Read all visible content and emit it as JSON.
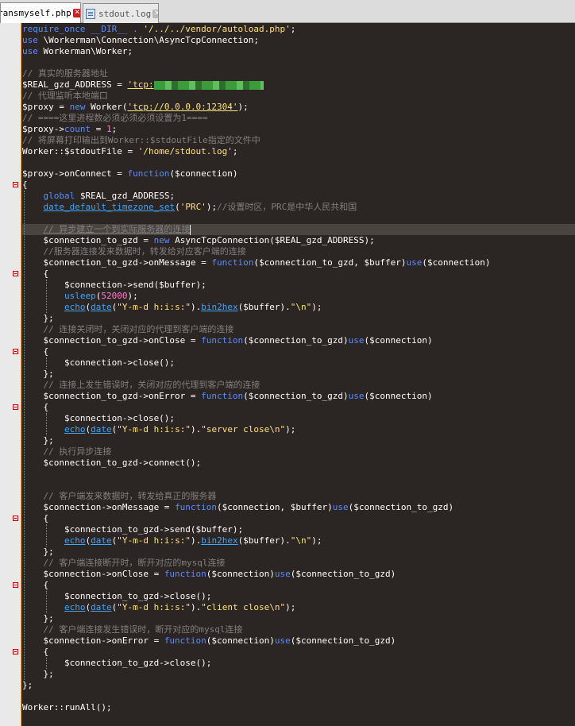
{
  "tabs": [
    {
      "label": "ransmyself.php",
      "active": true
    },
    {
      "label": "stdout.log",
      "active": false
    }
  ],
  "code_lines": [
    [
      [
        "kw",
        "require_once __DIR__ . "
      ],
      [
        "str",
        "'/../../vendor/autoload.php'"
      ],
      [
        "var",
        ";"
      ]
    ],
    [
      [
        "kw",
        "use "
      ],
      [
        "var",
        "\\Workerman\\Connection\\AsyncTcpConnection;"
      ]
    ],
    [
      [
        "kw",
        "use "
      ],
      [
        "var",
        "Workerman\\Worker;"
      ]
    ],
    [],
    [
      [
        "cm",
        "// 真实的服务器地址"
      ]
    ],
    [
      [
        "var",
        "$REAL_gzd_ADDRESS = "
      ],
      [
        "str",
        "'tcp:"
      ]
    ],
    [
      [
        "cm",
        "// 代理监听本地端口"
      ]
    ],
    [
      [
        "var",
        "$proxy = "
      ],
      [
        "kw",
        "new "
      ],
      [
        "var",
        "Worker("
      ],
      [
        "str",
        "'tcp://0.0.0.0:12304'"
      ],
      [
        "var",
        ");"
      ]
    ],
    [
      [
        "cm",
        "// ====这里进程数必须必须必须设置为1===="
      ]
    ],
    [
      [
        "var",
        "$proxy->"
      ],
      [
        "kw",
        "count"
      ],
      [
        "var",
        " = "
      ],
      [
        "num",
        "1"
      ],
      [
        "var",
        ";"
      ]
    ],
    [
      [
        "cm",
        "// 将屏幕打印输出到Worker::$stdoutFile指定的文件中"
      ]
    ],
    [
      [
        "var",
        "Worker::$stdoutFile = "
      ],
      [
        "str",
        "'/home/stdout.log'"
      ],
      [
        "var",
        ";"
      ]
    ],
    [],
    [
      [
        "var",
        "$proxy->onConnect = "
      ],
      [
        "kw",
        "function"
      ],
      [
        "var",
        "($connection)"
      ]
    ],
    [
      [
        "var",
        "{"
      ]
    ],
    [
      [
        "var",
        "    "
      ],
      [
        "kw",
        "global "
      ],
      [
        "var",
        "$REAL_gzd_ADDRESS;"
      ]
    ],
    [
      [
        "var",
        "    "
      ],
      [
        "fn2",
        "date_default_timezone_set"
      ],
      [
        "var",
        "("
      ],
      [
        "str",
        "'PRC'"
      ],
      [
        "var",
        ");"
      ],
      [
        "cm",
        "//设置时区，PRC是中华人民共和国"
      ]
    ],
    [],
    [
      [
        "var",
        "    "
      ],
      [
        "cm",
        "// 异步建立一个到实际服务器的连接"
      ]
    ],
    [
      [
        "var",
        "    $connection_to_gzd = "
      ],
      [
        "kw",
        "new "
      ],
      [
        "var",
        "AsyncTcpConnection($REAL_gzd_ADDRESS);"
      ]
    ],
    [
      [
        "var",
        "    "
      ],
      [
        "cm",
        "//服务器连接发来数据时，转发给对应客户端的连接"
      ]
    ],
    [
      [
        "var",
        "    $connection_to_gzd->onMessage = "
      ],
      [
        "kw",
        "function"
      ],
      [
        "var",
        "($connection_to_gzd, $buffer)"
      ],
      [
        "kw",
        "use"
      ],
      [
        "var",
        "($connection)"
      ]
    ],
    [
      [
        "var",
        "    {"
      ]
    ],
    [
      [
        "var",
        "        $connection->send($buffer);"
      ]
    ],
    [
      [
        "var",
        "        "
      ],
      [
        "fn2",
        "usleep"
      ],
      [
        "var",
        "("
      ],
      [
        "num",
        "52000"
      ],
      [
        "var",
        ");"
      ]
    ],
    [
      [
        "var",
        "        "
      ],
      [
        "fn2",
        "echo"
      ],
      [
        "var",
        "("
      ],
      [
        "fn2",
        "date"
      ],
      [
        "var",
        "("
      ],
      [
        "str",
        "\"Y-m-d h:i:s:\""
      ],
      [
        "var",
        ")."
      ],
      [
        "fn2",
        "bin2hex"
      ],
      [
        "var",
        "($buffer)."
      ],
      [
        "str",
        "\"\\n\""
      ],
      [
        "var",
        ");"
      ]
    ],
    [
      [
        "var",
        "    };"
      ]
    ],
    [
      [
        "var",
        "    "
      ],
      [
        "cm",
        "// 连接关闭时，关闭对应的代理到客户端的连接"
      ]
    ],
    [
      [
        "var",
        "    $connection_to_gzd->onClose = "
      ],
      [
        "kw",
        "function"
      ],
      [
        "var",
        "($connection_to_gzd)"
      ],
      [
        "kw",
        "use"
      ],
      [
        "var",
        "($connection)"
      ]
    ],
    [
      [
        "var",
        "    {"
      ]
    ],
    [
      [
        "var",
        "        $connection->close();"
      ]
    ],
    [
      [
        "var",
        "    };"
      ]
    ],
    [
      [
        "var",
        "    "
      ],
      [
        "cm",
        "// 连接上发生错误时，关闭对应的代理到客户端的连接"
      ]
    ],
    [
      [
        "var",
        "    $connection_to_gzd->onError = "
      ],
      [
        "kw",
        "function"
      ],
      [
        "var",
        "($connection_to_gzd)"
      ],
      [
        "kw",
        "use"
      ],
      [
        "var",
        "($connection)"
      ]
    ],
    [
      [
        "var",
        "    {"
      ]
    ],
    [
      [
        "var",
        "        $connection->close();"
      ]
    ],
    [
      [
        "var",
        "        "
      ],
      [
        "fn2",
        "echo"
      ],
      [
        "var",
        "("
      ],
      [
        "fn2",
        "date"
      ],
      [
        "var",
        "("
      ],
      [
        "str",
        "\"Y-m-d h:i:s:\""
      ],
      [
        "var",
        ")."
      ],
      [
        "str",
        "\"server close\\n\""
      ],
      [
        "var",
        ");"
      ]
    ],
    [
      [
        "var",
        "    };"
      ]
    ],
    [
      [
        "var",
        "    "
      ],
      [
        "cm",
        "// 执行异步连接"
      ]
    ],
    [
      [
        "var",
        "    $connection_to_gzd->connect();"
      ]
    ],
    [],
    [],
    [
      [
        "var",
        "    "
      ],
      [
        "cm",
        "// 客户端发来数据时，转发给真正的服务器"
      ]
    ],
    [
      [
        "var",
        "    $connection->onMessage = "
      ],
      [
        "kw",
        "function"
      ],
      [
        "var",
        "($connection, $buffer)"
      ],
      [
        "kw",
        "use"
      ],
      [
        "var",
        "($connection_to_gzd)"
      ]
    ],
    [
      [
        "var",
        "    {"
      ]
    ],
    [
      [
        "var",
        "        $connection_to_gzd->send($buffer);"
      ]
    ],
    [
      [
        "var",
        "        "
      ],
      [
        "fn2",
        "echo"
      ],
      [
        "var",
        "("
      ],
      [
        "fn2",
        "date"
      ],
      [
        "var",
        "("
      ],
      [
        "str",
        "\"Y-m-d h:i:s:\""
      ],
      [
        "var",
        ")."
      ],
      [
        "fn2",
        "bin2hex"
      ],
      [
        "var",
        "($buffer)."
      ],
      [
        "str",
        "\"\\n\""
      ],
      [
        "var",
        ");"
      ]
    ],
    [
      [
        "var",
        "    };"
      ]
    ],
    [
      [
        "var",
        "    "
      ],
      [
        "cm",
        "// 客户端连接断开时，断开对应的mysql连接"
      ]
    ],
    [
      [
        "var",
        "    $connection->onClose = "
      ],
      [
        "kw",
        "function"
      ],
      [
        "var",
        "($connection)"
      ],
      [
        "kw",
        "use"
      ],
      [
        "var",
        "($connection_to_gzd)"
      ]
    ],
    [
      [
        "var",
        "    {"
      ]
    ],
    [
      [
        "var",
        "        $connection_to_gzd->close();"
      ]
    ],
    [
      [
        "var",
        "        "
      ],
      [
        "fn2",
        "echo"
      ],
      [
        "var",
        "("
      ],
      [
        "fn2",
        "date"
      ],
      [
        "var",
        "("
      ],
      [
        "str",
        "\"Y-m-d h:i:s:\""
      ],
      [
        "var",
        ")."
      ],
      [
        "str",
        "\"client close\\n\""
      ],
      [
        "var",
        ");"
      ]
    ],
    [
      [
        "var",
        "    };"
      ]
    ],
    [
      [
        "var",
        "    "
      ],
      [
        "cm",
        "// 客户端连接发生错误时，断开对应的mysql连接"
      ]
    ],
    [
      [
        "var",
        "    $connection->onError = "
      ],
      [
        "kw",
        "function"
      ],
      [
        "var",
        "($connection)"
      ],
      [
        "kw",
        "use"
      ],
      [
        "var",
        "($connection_to_gzd)"
      ]
    ],
    [
      [
        "var",
        "    {"
      ]
    ],
    [
      [
        "var",
        "        $connection_to_gzd->close();"
      ]
    ],
    [
      [
        "var",
        "    };"
      ]
    ],
    [
      [
        "var",
        "};"
      ]
    ],
    [],
    [
      [
        "var",
        "Worker::runAll();"
      ]
    ]
  ],
  "colors": {
    "editor_background": "#2b2523",
    "gutter": "#e9e9e9",
    "comment": "#808080",
    "keyword": "#5b8cff",
    "string": "#ffe27a",
    "number": "#ff7ad0",
    "builtin": "#3da5ff"
  }
}
